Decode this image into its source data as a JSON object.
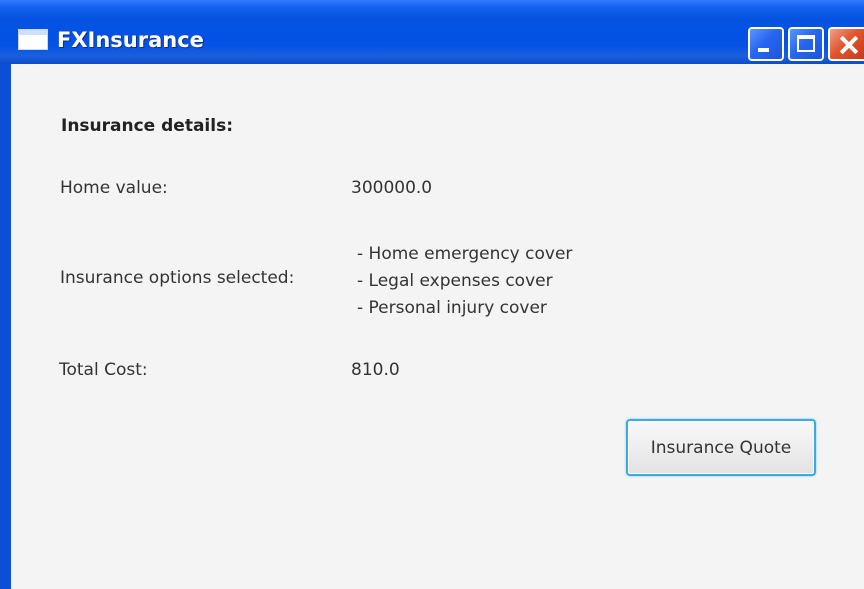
{
  "window": {
    "title": "FXInsurance"
  },
  "details": {
    "heading": "Insurance details:",
    "home_value_label": "Home value:",
    "home_value": "300000.0",
    "options_label": "Insurance options selected:",
    "options": [
      "- Home emergency cover",
      "- Legal expenses cover",
      "- Personal injury cover"
    ],
    "total_cost_label": "Total Cost:",
    "total_cost": "810.0"
  },
  "actions": {
    "quote_label": "Insurance Quote"
  },
  "icons": {
    "app": "window-app-icon",
    "minimize": "minimize-icon",
    "maximize": "maximize-icon",
    "close": "close-icon"
  },
  "colors": {
    "titlebar": "#0553e0",
    "content_background": "#f4f4f4",
    "button_focus_border": "#3ea8e0",
    "close_button": "#e0552e"
  }
}
